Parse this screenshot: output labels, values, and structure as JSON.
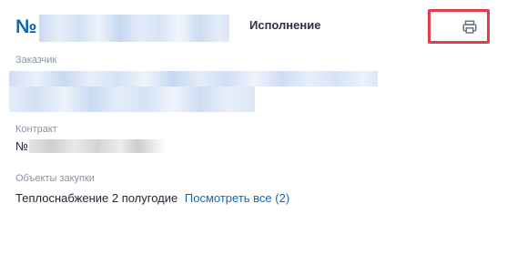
{
  "header": {
    "number_prefix": "№",
    "status": "Исполнение",
    "print_icon": "printer-icon",
    "print_highlight_color": "#e0404b"
  },
  "customer": {
    "label": "Заказчик"
  },
  "contract": {
    "label": "Контракт",
    "number_prefix": "№"
  },
  "objects": {
    "label": "Объекты закупки",
    "text": "Теплоснабжение 2 полугодие",
    "link": "Посмотреть все (2)"
  },
  "colors": {
    "accent": "#0f62ae",
    "link": "#1565c0",
    "label": "#8a93a6"
  }
}
